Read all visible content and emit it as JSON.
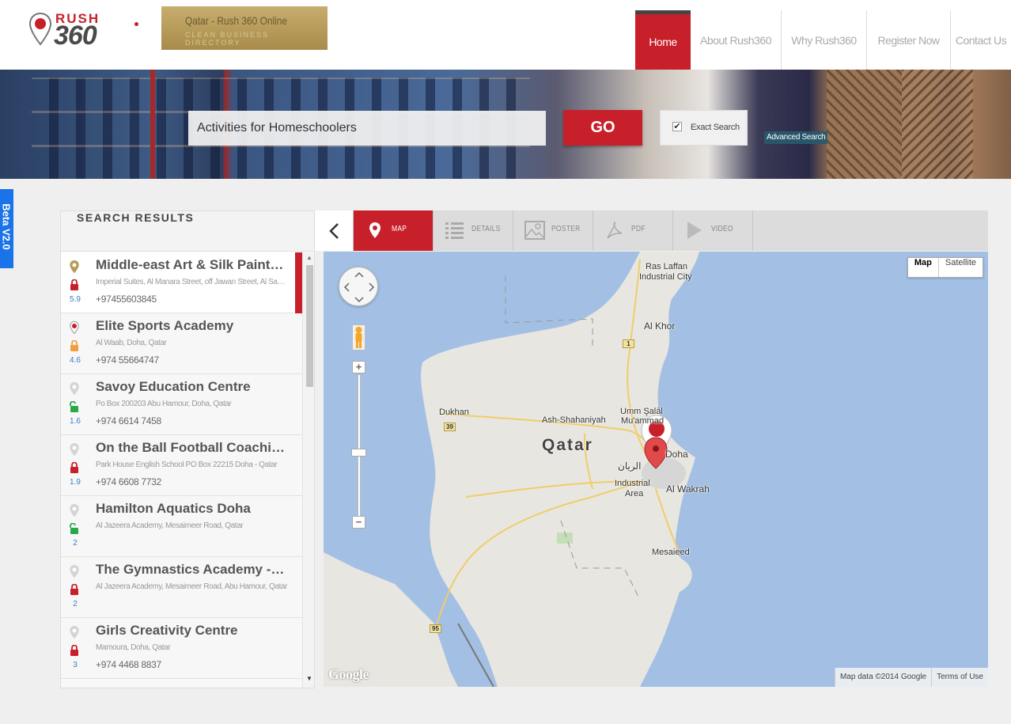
{
  "brand": {
    "logo_top": "RUSH",
    "logo_bottom": "360"
  },
  "tagline": {
    "title": "Qatar - Rush 360 Online",
    "subtitle": "CLEAN BUSINESS DIRECTORY"
  },
  "nav": {
    "items": [
      {
        "label": "Home",
        "active": true
      },
      {
        "label": "About Rush360",
        "active": false
      },
      {
        "label": "Why Rush360",
        "active": false
      },
      {
        "label": "Register Now",
        "active": false
      },
      {
        "label": "Contact Us",
        "active": false
      }
    ]
  },
  "search": {
    "value": "Activities for Homeschoolers",
    "go_label": "GO",
    "exact_label": "Exact Search",
    "exact_checked": true,
    "advanced_label": "Advanced Search"
  },
  "beta_label": "Beta V2.0",
  "results": {
    "heading": "SEARCH RESULTS",
    "items": [
      {
        "name": "Middle-east Art & Silk Painting",
        "address": "Imperial Suites, Al Manara Street, off Jawan Street, Al Sadd, Doha",
        "phone": "+97455603845",
        "score": "5.9",
        "pin": "gold",
        "lock": "locked-red"
      },
      {
        "name": "Elite Sports Academy",
        "address": "Al Waab, Doha, Qatar",
        "phone": "+974 55664747",
        "score": "4.6",
        "pin": "red",
        "lock": "locked-orange"
      },
      {
        "name": "Savoy Education Centre",
        "address": "Po Box 200203 Abu Hamour, Doha, Qatar",
        "phone": "+974 6614 7458",
        "score": "1.6",
        "pin": "grey",
        "lock": "unlocked-green"
      },
      {
        "name": "On the Ball Football Coaching",
        "address": "Park House English School PO Box 22215 Doha - Qatar",
        "phone": "+974 6608 7732",
        "score": "1.9",
        "pin": "grey",
        "lock": "locked-red"
      },
      {
        "name": "Hamilton Aquatics Doha",
        "address": "Al Jazeera Academy, Mesaimeer Road, Qatar",
        "phone": "",
        "score": "2",
        "pin": "grey",
        "lock": "unlocked-green"
      },
      {
        "name": "The Gymnastics Academy - Doha",
        "address": "Al Jazeera Academy, Mesaimeer Road, Abu Hamour, Qatar",
        "phone": "",
        "score": "2",
        "pin": "grey",
        "lock": "locked-red"
      },
      {
        "name": "Girls Creativity Centre",
        "address": "Mamoura, Doha, Qatar",
        "phone": "+974 4468 8837",
        "score": "3",
        "pin": "grey",
        "lock": "locked-red"
      }
    ]
  },
  "tabs": [
    {
      "label": "MAP",
      "icon": "map-pin-icon",
      "active": true
    },
    {
      "label": "DETAILS",
      "icon": "list-icon",
      "active": false
    },
    {
      "label": "POSTER",
      "icon": "image-icon",
      "active": false
    },
    {
      "label": "PDF",
      "icon": "pdf-icon",
      "active": false
    },
    {
      "label": "VIDEO",
      "icon": "play-icon",
      "active": false
    }
  ],
  "map": {
    "type_options": [
      "Map",
      "Satellite"
    ],
    "selected_type": "Map",
    "labels": {
      "country": "Qatar",
      "ras_laffan": "Ras Laffan",
      "ras_laffan2": "Industrial City",
      "al_khor": "Al Khor",
      "dukhan": "Dukhan",
      "shahaniyah": "Ash-Shahaniyah",
      "umm_salal": "Umm Şalāl",
      "umm_salal2": "Mu'ammad",
      "doha": "Doha",
      "rayyan": "الريان",
      "industrial": "Industrial",
      "industrial2": "Area",
      "wakrah": "Al Wakrah",
      "mesaieed": "Mesaieed"
    },
    "road_shields": [
      "1",
      "39",
      "95"
    ],
    "google_label": "Google",
    "attribution": "Map data ©2014 Google",
    "terms": "Terms of Use",
    "colors": {
      "water": "#a3c0e4",
      "land": "#e8e6e0",
      "road": "#f0cd6a",
      "marker": "#c8202a"
    }
  },
  "colors": {
    "accent": "#c8202a",
    "beta": "#1a73e8",
    "gold": "#b69a58"
  }
}
